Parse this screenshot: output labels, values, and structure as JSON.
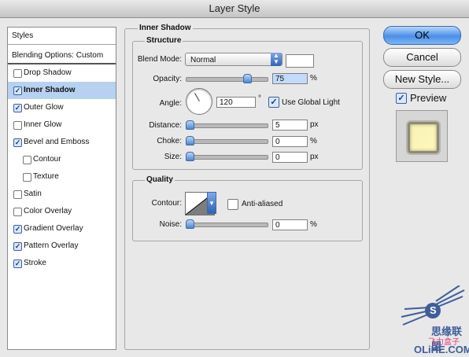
{
  "window": {
    "title": "Layer Style"
  },
  "left_panel": {
    "styles_header": "Styles",
    "blending_header": "Blending Options: Custom",
    "items": [
      {
        "label": "Drop Shadow",
        "checked": false,
        "indent": false,
        "selected": false
      },
      {
        "label": "Inner Shadow",
        "checked": true,
        "indent": false,
        "selected": true
      },
      {
        "label": "Outer Glow",
        "checked": true,
        "indent": false,
        "selected": false
      },
      {
        "label": "Inner Glow",
        "checked": false,
        "indent": false,
        "selected": false
      },
      {
        "label": "Bevel and Emboss",
        "checked": true,
        "indent": false,
        "selected": false
      },
      {
        "label": "Contour",
        "checked": false,
        "indent": true,
        "selected": false
      },
      {
        "label": "Texture",
        "checked": false,
        "indent": true,
        "selected": false
      },
      {
        "label": "Satin",
        "checked": false,
        "indent": false,
        "selected": false
      },
      {
        "label": "Color Overlay",
        "checked": false,
        "indent": false,
        "selected": false
      },
      {
        "label": "Gradient Overlay",
        "checked": true,
        "indent": false,
        "selected": false
      },
      {
        "label": "Pattern Overlay",
        "checked": true,
        "indent": false,
        "selected": false
      },
      {
        "label": "Stroke",
        "checked": true,
        "indent": false,
        "selected": false
      }
    ]
  },
  "inner_shadow": {
    "title": "Inner Shadow",
    "structure": {
      "title": "Structure",
      "blend_mode_label": "Blend Mode:",
      "blend_mode_value": "Normal",
      "opacity_label": "Opacity:",
      "opacity_value": "75",
      "opacity_unit": "%",
      "opacity_fraction": 0.75,
      "angle_label": "Angle:",
      "angle_value": "120",
      "angle_unit": "°",
      "use_global_light_label": "Use Global Light",
      "use_global_light": true,
      "distance_label": "Distance:",
      "distance_value": "5",
      "distance_unit": "px",
      "choke_label": "Choke:",
      "choke_value": "0",
      "choke_unit": "%",
      "size_label": "Size:",
      "size_value": "0",
      "size_unit": "px"
    },
    "quality": {
      "title": "Quality",
      "contour_label": "Contour:",
      "anti_aliased_label": "Anti-aliased",
      "anti_aliased": false,
      "noise_label": "Noise:",
      "noise_value": "0",
      "noise_unit": "%"
    }
  },
  "buttons": {
    "ok": "OK",
    "cancel": "Cancel",
    "new_style": "New Style...",
    "preview_label": "Preview",
    "preview_checked": true
  },
  "watermark": {
    "brand_chinese": "思缘联盟",
    "brand_small": "飞力盒子",
    "brand_url": "OLiHE.COM",
    "logo_letter": "S"
  },
  "colors": {
    "accent": "#4a8fe8",
    "selection": "#b6d2f0",
    "preview_fill": "#fff7bd",
    "watermark": "#3e5d9a",
    "watermark_pink": "#e0407a"
  }
}
